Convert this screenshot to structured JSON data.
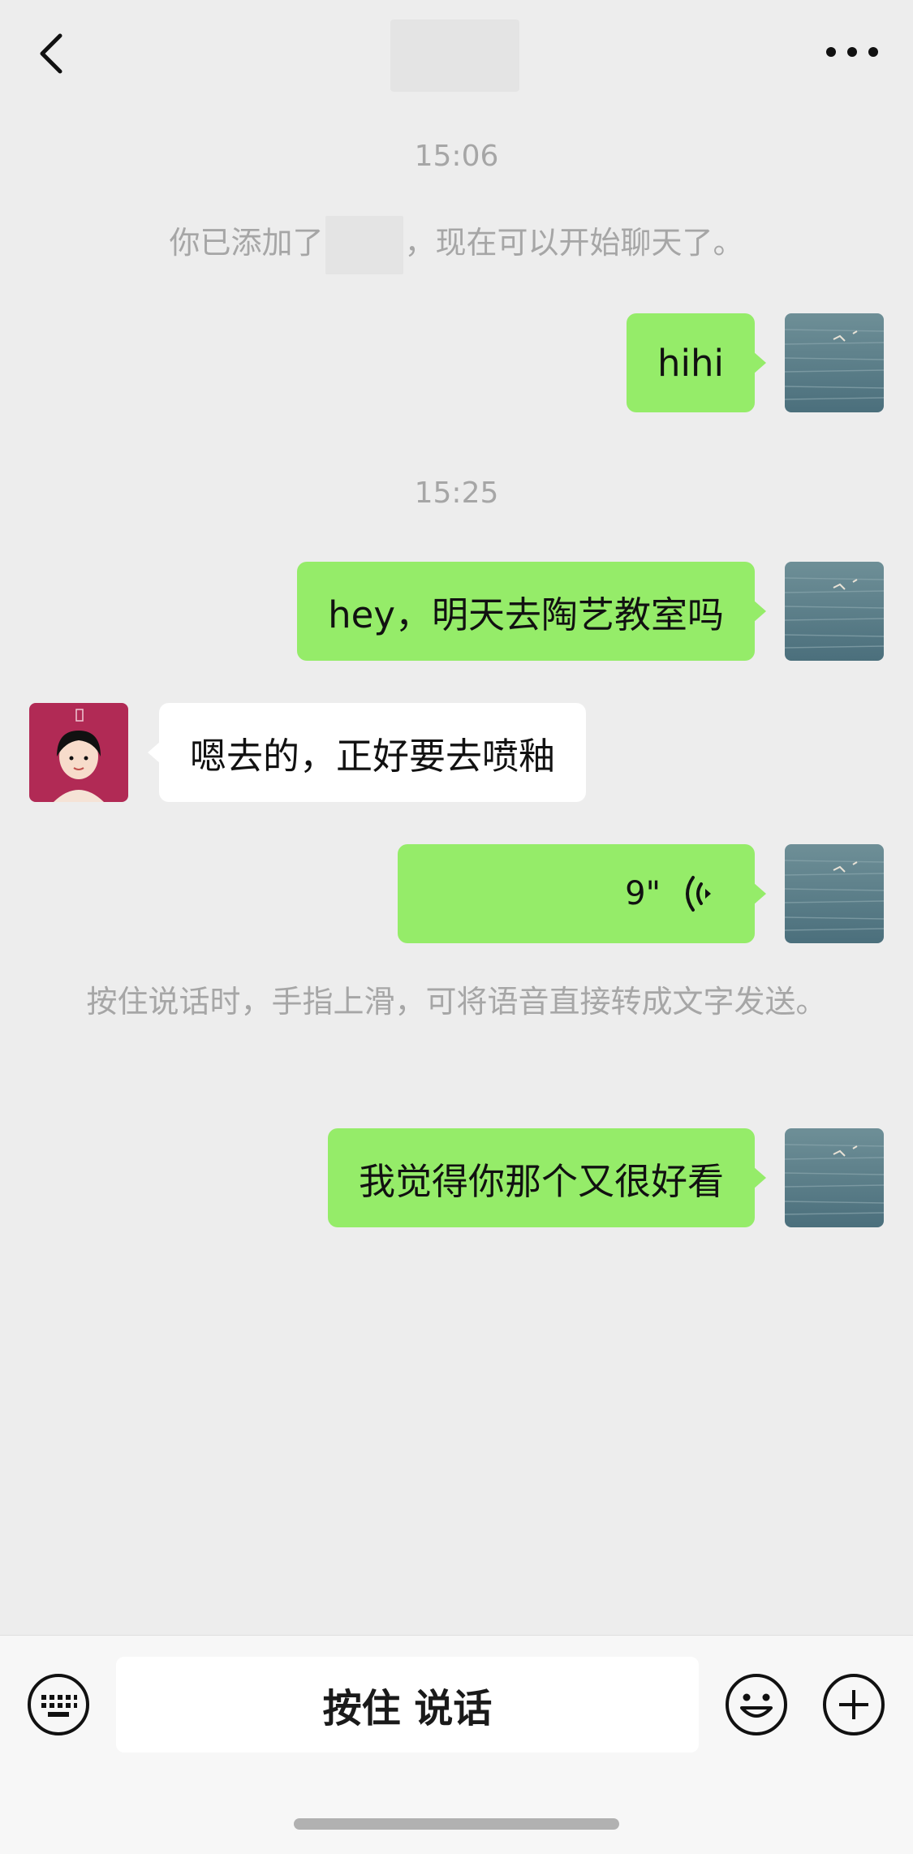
{
  "header": {
    "back_icon": "chevron-left-icon",
    "more_icon": "more-dots-icon"
  },
  "messages": {
    "time1": "15:06",
    "system_added_prefix": "你已添加了",
    "system_added_suffix": "，现在可以开始聊天了。",
    "msg1": "hihi",
    "time2": "15:25",
    "msg2": "hey，明天去陶艺教室吗",
    "msg3": "嗯去的，正好要去喷釉",
    "voice_duration": "9\"",
    "voice_hint": "按住说话时，手指上滑，可将语音直接转成文字发送。",
    "msg5": "我觉得你那个又很好看"
  },
  "input": {
    "hold_to_talk": "按住 说话",
    "keyboard_icon": "keyboard-icon",
    "emoji_icon": "emoji-icon",
    "plus_icon": "plus-icon"
  },
  "colors": {
    "outgoing_bubble": "#95ec69",
    "incoming_bubble": "#ffffff",
    "background": "#ededed",
    "avatar_other_bg": "#b12a55"
  }
}
